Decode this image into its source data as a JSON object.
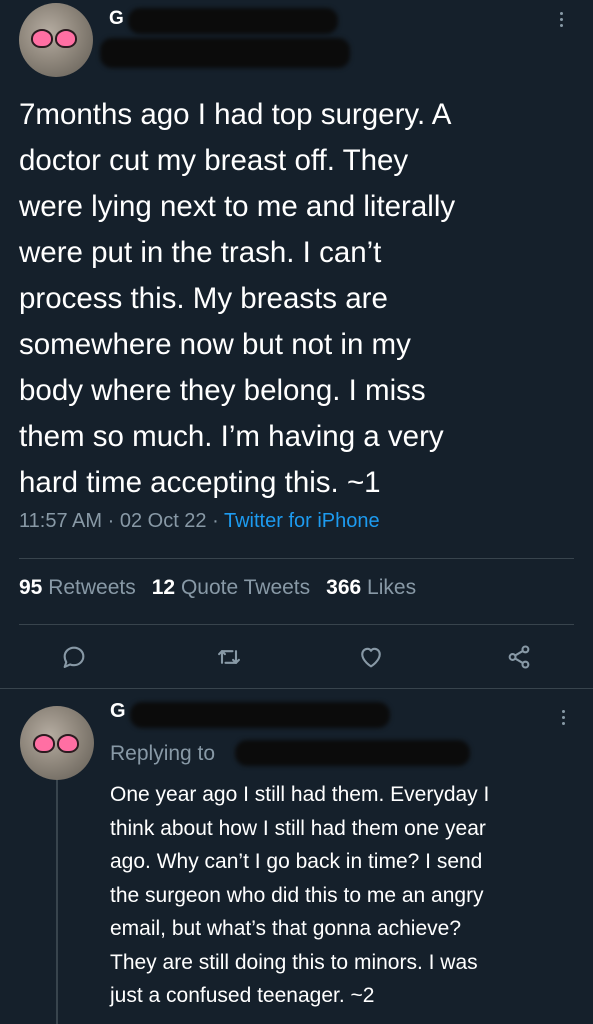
{
  "tweet": {
    "author_initial": "G",
    "text": "7months ago I had top surgery. A\ndoctor cut my breast off. They\nwere lying next to me and literally\nwere put in the trash. I can’t\nprocess this. My breasts are\nsomewhere now but not in my\nbody where they belong. I miss\nthem so much. I’m having a very\nhard time accepting this. ~1",
    "time": "11:57 AM",
    "date": "02 Oct 22",
    "separator": "·",
    "source": "Twitter for iPhone"
  },
  "stats": {
    "retweets_count": "95",
    "retweets_label": "Retweets",
    "quote_count": "12",
    "quote_label": "Quote Tweets",
    "likes_count": "366",
    "likes_label": "Likes"
  },
  "actions": {
    "icons": [
      "reply-icon",
      "retweet-icon",
      "like-icon",
      "share-icon"
    ]
  },
  "reply": {
    "author_initial": "G",
    "replying_label": "Replying to",
    "text": "One year ago I still had them. Everyday I\nthink about how I still had them one year\nago. Why can’t I go back in time? I send\nthe surgeon who did this to me an angry\nemail, but what’s that gonna achieve?\nThey are still doing this to minors. I was\njust a confused teenager. ~2"
  },
  "colors": {
    "background": "#15202b",
    "secondary_text": "#8899a6",
    "link": "#1d9bf0",
    "divider": "#38444d"
  }
}
